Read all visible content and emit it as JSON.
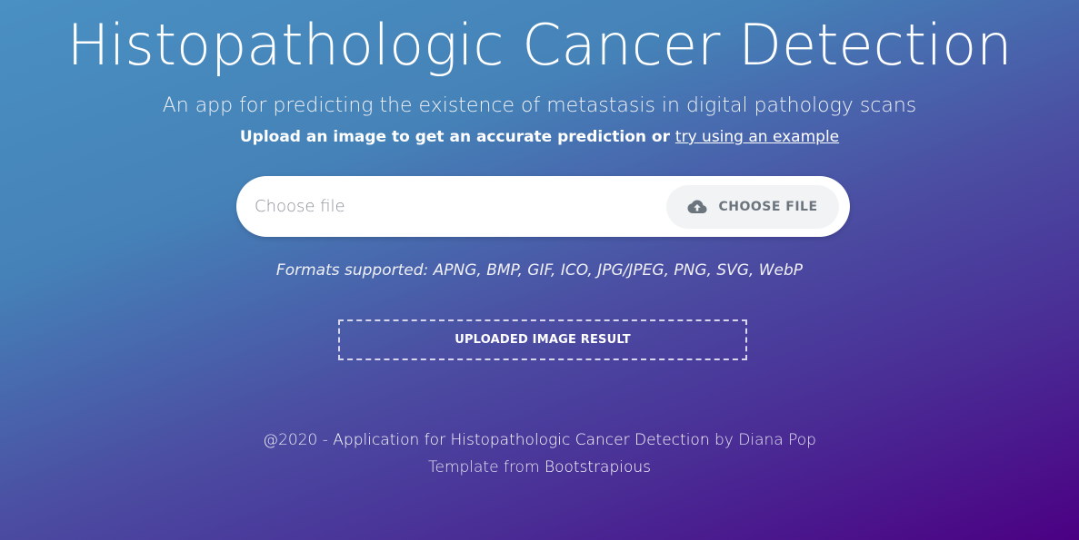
{
  "header": {
    "title": "Histopathologic Cancer Detection",
    "subtitle": "An app for predicting the existence of metastasis in digital pathology scans",
    "upload_prompt": "Upload an image to get an accurate prediction or",
    "example_link": "try using an example"
  },
  "file_input": {
    "placeholder": "Choose file",
    "button_label": "CHOOSE FILE",
    "button_icon": "cloud-upload-icon"
  },
  "formats_text": "Formats supported: APNG, BMP, GIF, ICO, JPG/JPEG, PNG, SVG, WebP",
  "result": {
    "label": "UPLOADED IMAGE RESULT"
  },
  "footer": {
    "copyright": "@2020 -",
    "app_link": "Application for Histopathologic Cancer Detection",
    "by_text": "by Diana Pop",
    "template_text": "Template from",
    "template_link": "Bootstrapious"
  },
  "colors": {
    "gradient_start": "#4a90c2",
    "gradient_end": "#4b0083",
    "button_bg": "#f1f3f5",
    "button_text": "#6c757d"
  }
}
